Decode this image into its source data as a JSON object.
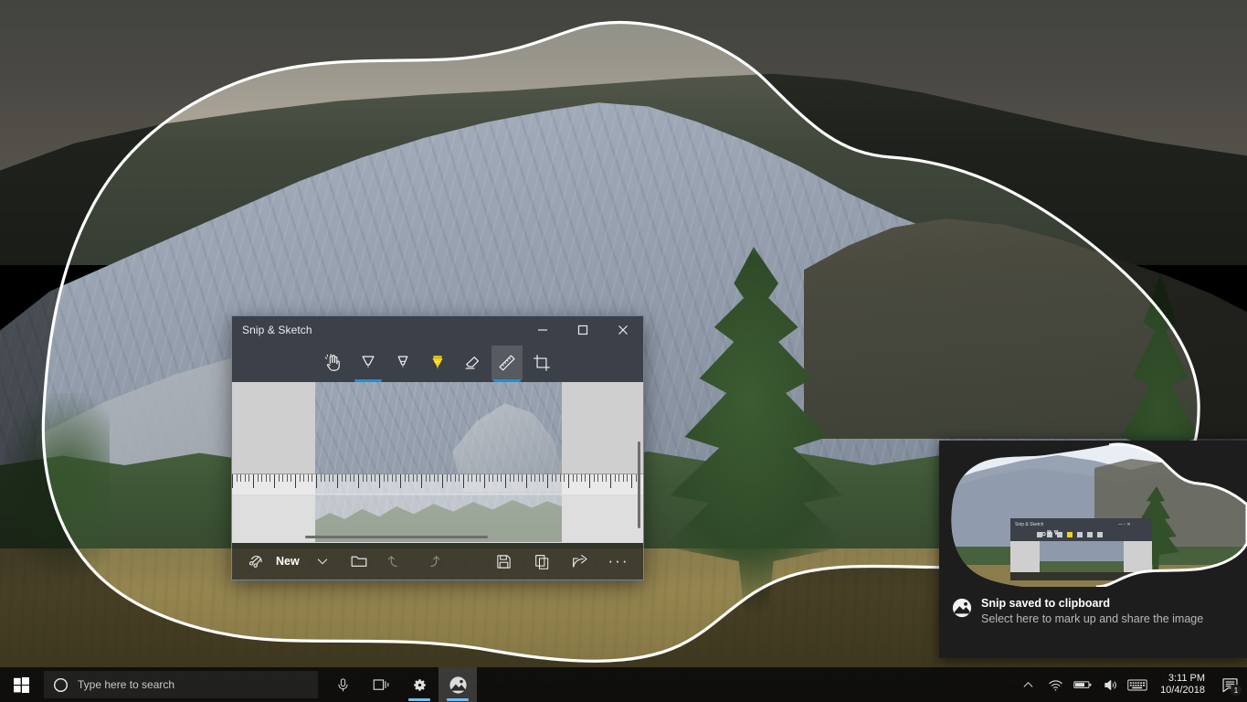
{
  "desktop": {
    "wallpaper_alt": "Yellowstone mountain valley with conifer trees and meadow",
    "snip_mode": "free-form-snip",
    "outline_color": "#ffffff"
  },
  "window": {
    "title": "Snip & Sketch",
    "controls": {
      "minimize": "—",
      "maximize": "☐",
      "close": "✕"
    },
    "tools": [
      {
        "name": "touch-writing",
        "label": "Touch writing",
        "selected": false,
        "accent": ""
      },
      {
        "name": "ballpoint-pen",
        "label": "Ballpoint pen",
        "selected": false,
        "accent": "#1e90d6"
      },
      {
        "name": "pencil",
        "label": "Pencil",
        "selected": false,
        "accent": ""
      },
      {
        "name": "highlighter",
        "label": "Highlighter",
        "selected": false,
        "accent": "#f5d018"
      },
      {
        "name": "eraser",
        "label": "Eraser",
        "selected": false,
        "accent": ""
      },
      {
        "name": "ruler",
        "label": "Ruler",
        "selected": true,
        "accent": "#1e90d6"
      },
      {
        "name": "image-crop",
        "label": "Image crop",
        "selected": false,
        "accent": ""
      }
    ],
    "bottom_toolbar": {
      "new_label": "New",
      "new_icon": "new-snip-icon",
      "dropdown_icon": "chevron-down-icon",
      "open_icon": "open-file-icon",
      "undo_icon": "undo-icon",
      "redo_icon": "redo-icon",
      "save_icon": "save-icon",
      "copy_icon": "copy-icon",
      "share_icon": "share-icon",
      "more_icon": "more-ellipsis-icon",
      "more_label": "···"
    },
    "canvas": {
      "ruler_visible": true,
      "has_vertical_scrollbar": true,
      "has_horizontal_scrollbar": true
    }
  },
  "toast": {
    "app_icon": "snip-sketch-icon",
    "title": "Snip saved to clipboard",
    "body": "Select here to mark up and share the image"
  },
  "taskbar": {
    "start_label": "start-button",
    "search": {
      "icon": "cortana-circle-icon",
      "placeholder": "Type here to search"
    },
    "icons": [
      {
        "name": "microphone-icon",
        "active": false,
        "underline": false
      },
      {
        "name": "task-view-icon",
        "active": false,
        "underline": false
      },
      {
        "name": "settings-gear-icon",
        "active": false,
        "underline": true
      },
      {
        "name": "snip-and-sketch-icon",
        "active": true,
        "underline": true
      }
    ],
    "tray": [
      {
        "name": "show-hidden-icons-chevron"
      },
      {
        "name": "wifi-icon"
      },
      {
        "name": "battery-icon"
      },
      {
        "name": "volume-icon"
      },
      {
        "name": "touch-keyboard-icon"
      }
    ],
    "clock": {
      "time": "3:11 PM",
      "date": "10/4/2018"
    },
    "action_center": {
      "name": "action-center-icon",
      "badge": "1"
    }
  }
}
